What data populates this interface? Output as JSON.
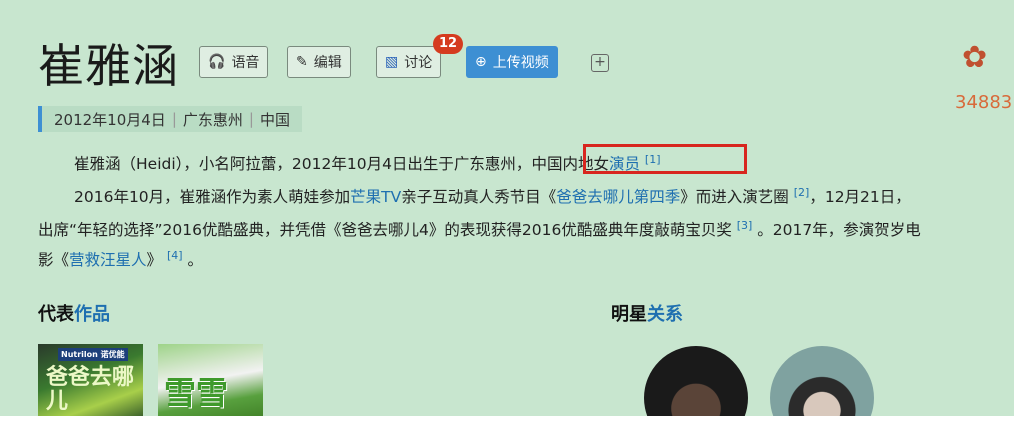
{
  "title": "崔雅涵",
  "toolbar": {
    "voice_label": "语音",
    "edit_label": "编辑",
    "discuss_label": "讨论",
    "discuss_badge": "12",
    "upload_label": "上传视频"
  },
  "flower_count": "34883",
  "meta": {
    "date": "2012年10月4日",
    "place": "广东惠州",
    "country": "中国"
  },
  "intro": {
    "p1_a": "崔雅涵（Heidi），小名阿拉蕾，2012年10月4日出生于广东惠州，",
    "p1_b": "中国内地女",
    "p1_link": "演员",
    "p1_ref": "[1]",
    "p2_a": "2016年10月，崔雅涵作为素人萌娃参加",
    "p2_link1": "芒果TV",
    "p2_b": "亲子互动真人秀节目《",
    "p2_link2": "爸爸去哪儿第四季",
    "p2_c": "》而进入演艺圈",
    "p2_ref1": "[2]",
    "p2_d": "，12月21日，",
    "p3_a": "出席“年轻的选择”2016优酷盛典，并凭借《爸爸去哪儿4》的表现获得2016优酷盛典年度敲萌宝贝奖",
    "p3_ref": "[3]",
    "p3_b": "。2017年，参演贺岁电",
    "p4_a": "影《",
    "p4_link": "营救汪星人",
    "p4_b": "》",
    "p4_ref": "[4]",
    "p4_c": "。"
  },
  "works_section": {
    "a": "代表",
    "b": "作品"
  },
  "works": [
    {
      "cover_brand": "Nutrilon 诺优能",
      "cover_text": "爸爸去哪儿"
    },
    {
      "cover_text": "雪雪"
    }
  ],
  "relations_section": {
    "a": "明星",
    "b": "关系"
  }
}
